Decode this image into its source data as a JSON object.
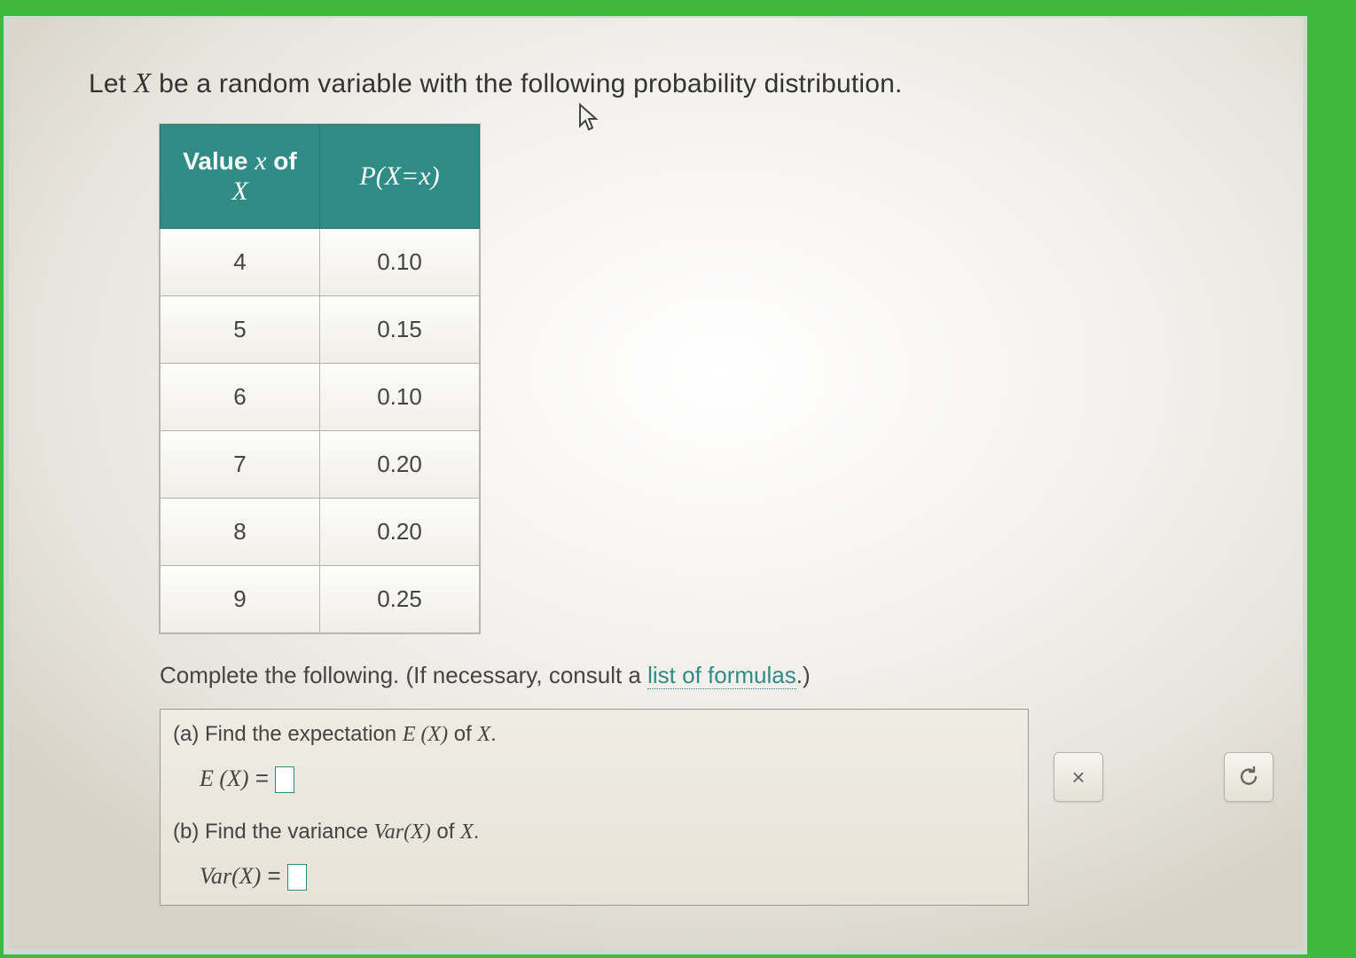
{
  "prompt": {
    "pre": "Let ",
    "var": "X",
    "post": " be a random variable with the following probability distribution."
  },
  "table": {
    "headers": {
      "col1_pre": "Value ",
      "col1_var": "x",
      "col1_post": " of ",
      "col1_var2": "X",
      "col2": "P(X=x)"
    },
    "rows": [
      {
        "x": "4",
        "p": "0.10"
      },
      {
        "x": "5",
        "p": "0.15"
      },
      {
        "x": "6",
        "p": "0.10"
      },
      {
        "x": "7",
        "p": "0.20"
      },
      {
        "x": "8",
        "p": "0.20"
      },
      {
        "x": "9",
        "p": "0.25"
      }
    ]
  },
  "instruction": {
    "pre": "Complete the following. (If necessary, consult a ",
    "link": "list of formulas",
    "post": ".)"
  },
  "parts": {
    "a": {
      "label": "(a) Find the expectation ",
      "fn": "E (X)",
      "of": " of ",
      "var": "X",
      "period": ".",
      "lhs": "E (X)",
      "eq": " = ",
      "value": ""
    },
    "b": {
      "label": "(b) Find the variance ",
      "fn": "Var(X)",
      "of": " of ",
      "var": "X",
      "period": ".",
      "lhs": "Var(X)",
      "eq": " = ",
      "value": ""
    }
  },
  "buttons": {
    "clear": "×",
    "redo": "↺"
  },
  "chart_data": {
    "type": "table",
    "title": "Probability distribution of X",
    "columns": [
      "x",
      "P(X=x)"
    ],
    "rows": [
      [
        4,
        0.1
      ],
      [
        5,
        0.15
      ],
      [
        6,
        0.1
      ],
      [
        7,
        0.2
      ],
      [
        8,
        0.2
      ],
      [
        9,
        0.25
      ]
    ]
  }
}
